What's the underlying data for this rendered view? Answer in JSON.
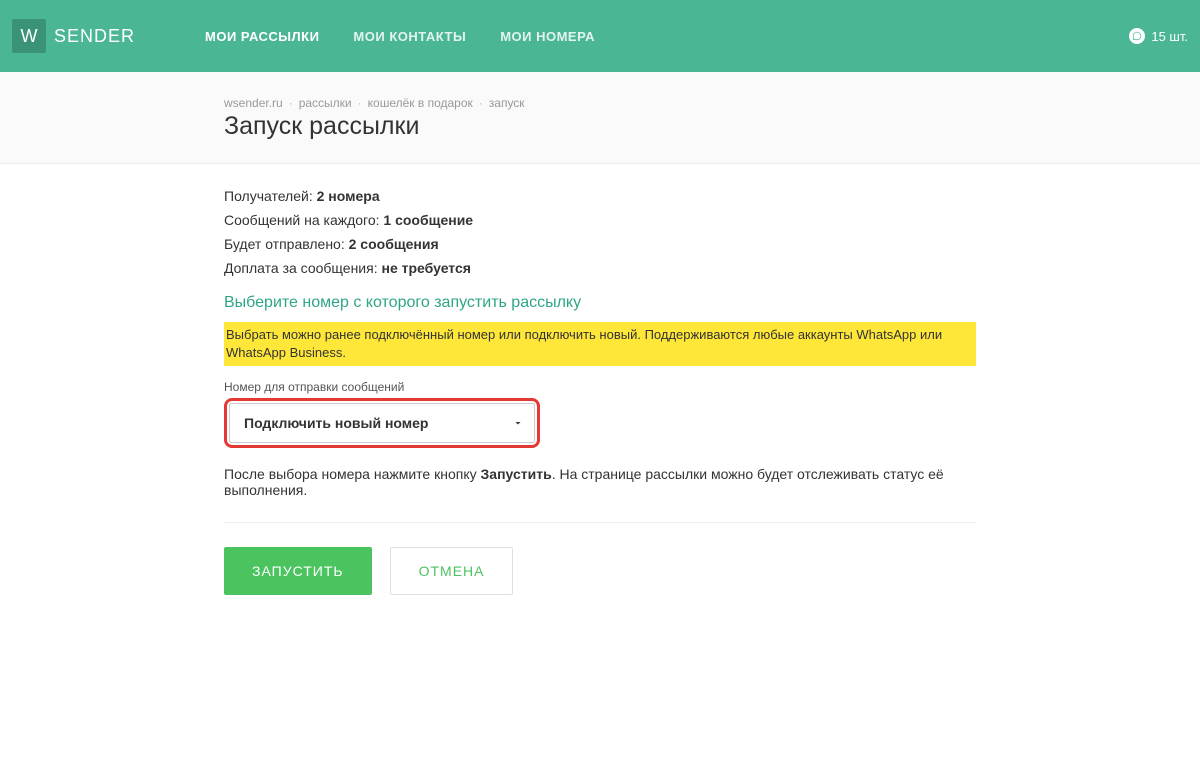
{
  "header": {
    "logo_letter": "W",
    "logo_text": "SENDER",
    "nav": [
      {
        "label": "МОИ РАССЫЛКИ",
        "active": true
      },
      {
        "label": "МОИ КОНТАКТЫ",
        "active": false
      },
      {
        "label": "МОИ НОМЕРА",
        "active": false
      }
    ],
    "balance": "15 шт."
  },
  "breadcrumb": {
    "items": [
      "wsender.ru",
      "рассылки",
      "кошелёк в подарок",
      "запуск"
    ]
  },
  "page_title": "Запуск рассылки",
  "summary": {
    "recipients_label": "Получателей: ",
    "recipients_value": "2 номера",
    "per_each_label": "Сообщений на каждого: ",
    "per_each_value": "1 сообщение",
    "total_label": "Будет отправлено: ",
    "total_value": "2 сообщения",
    "surcharge_label": "Доплата за сообщения: ",
    "surcharge_value": "не требуется"
  },
  "section_title": "Выберите номер с которого запустить рассылку",
  "hint": "Выбрать можно ранее подключённый номер или подключить новый. Поддерживаются любые аккаунты WhatsApp или WhatsApp Business.",
  "field": {
    "label": "Номер для отправки сообщений",
    "selected": "Подключить новый номер"
  },
  "info": {
    "pre": "После выбора номера нажмите кнопку ",
    "bold": "Запустить",
    "post": ". На странице рассылки можно будет отслеживать статус её выполнения."
  },
  "buttons": {
    "primary": "ЗАПУСТИТЬ",
    "secondary": "ОТМЕНА"
  }
}
